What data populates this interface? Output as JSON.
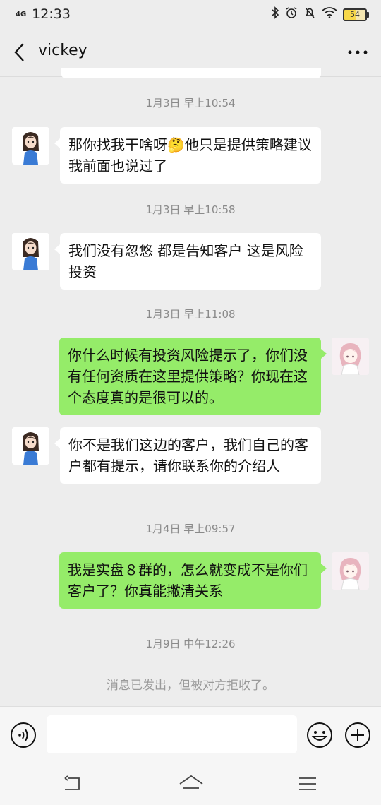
{
  "status_bar": {
    "network": "4G",
    "time": "12:33",
    "battery": "54"
  },
  "header": {
    "title": "vickey"
  },
  "messages": [
    {
      "timestamp": "1月3日 早上10:54",
      "side": "in",
      "text": "那你找我干啥呀🤔他只是提供策略建议 我前面也说过了"
    },
    {
      "timestamp": "1月3日 早上10:58",
      "side": "in",
      "text": "我们没有忽悠 都是告知客户 这是风险投资"
    },
    {
      "timestamp": "1月3日 早上11:08",
      "side": "out",
      "text": "你什么时候有投资风险提示了，你们没有任何资质在这里提供策略？你现在这个态度真的是很可以的。"
    },
    {
      "timestamp": "",
      "side": "in",
      "text": "你不是我们这边的客户，我们自己的客户都有提示，请你联系你的介绍人"
    },
    {
      "timestamp": "1月4日 早上09:57",
      "side": "out",
      "text": "我是实盘８群的，怎么就变成不是你们客户了？你真能撇清关系"
    }
  ],
  "last_timestamp": "1月9日 中午12:26",
  "system_note": "消息已发出，但被对方拒收了。",
  "input": {
    "value": "",
    "placeholder": ""
  },
  "colors": {
    "background": "#ededed",
    "outgoing_bubble": "#95ec69",
    "incoming_bubble": "#ffffff"
  },
  "icons": {
    "back": "back-arrow-icon",
    "more": "more-dots-icon",
    "voice": "voice-icon",
    "emoji": "emoji-icon",
    "plus": "plus-icon"
  }
}
